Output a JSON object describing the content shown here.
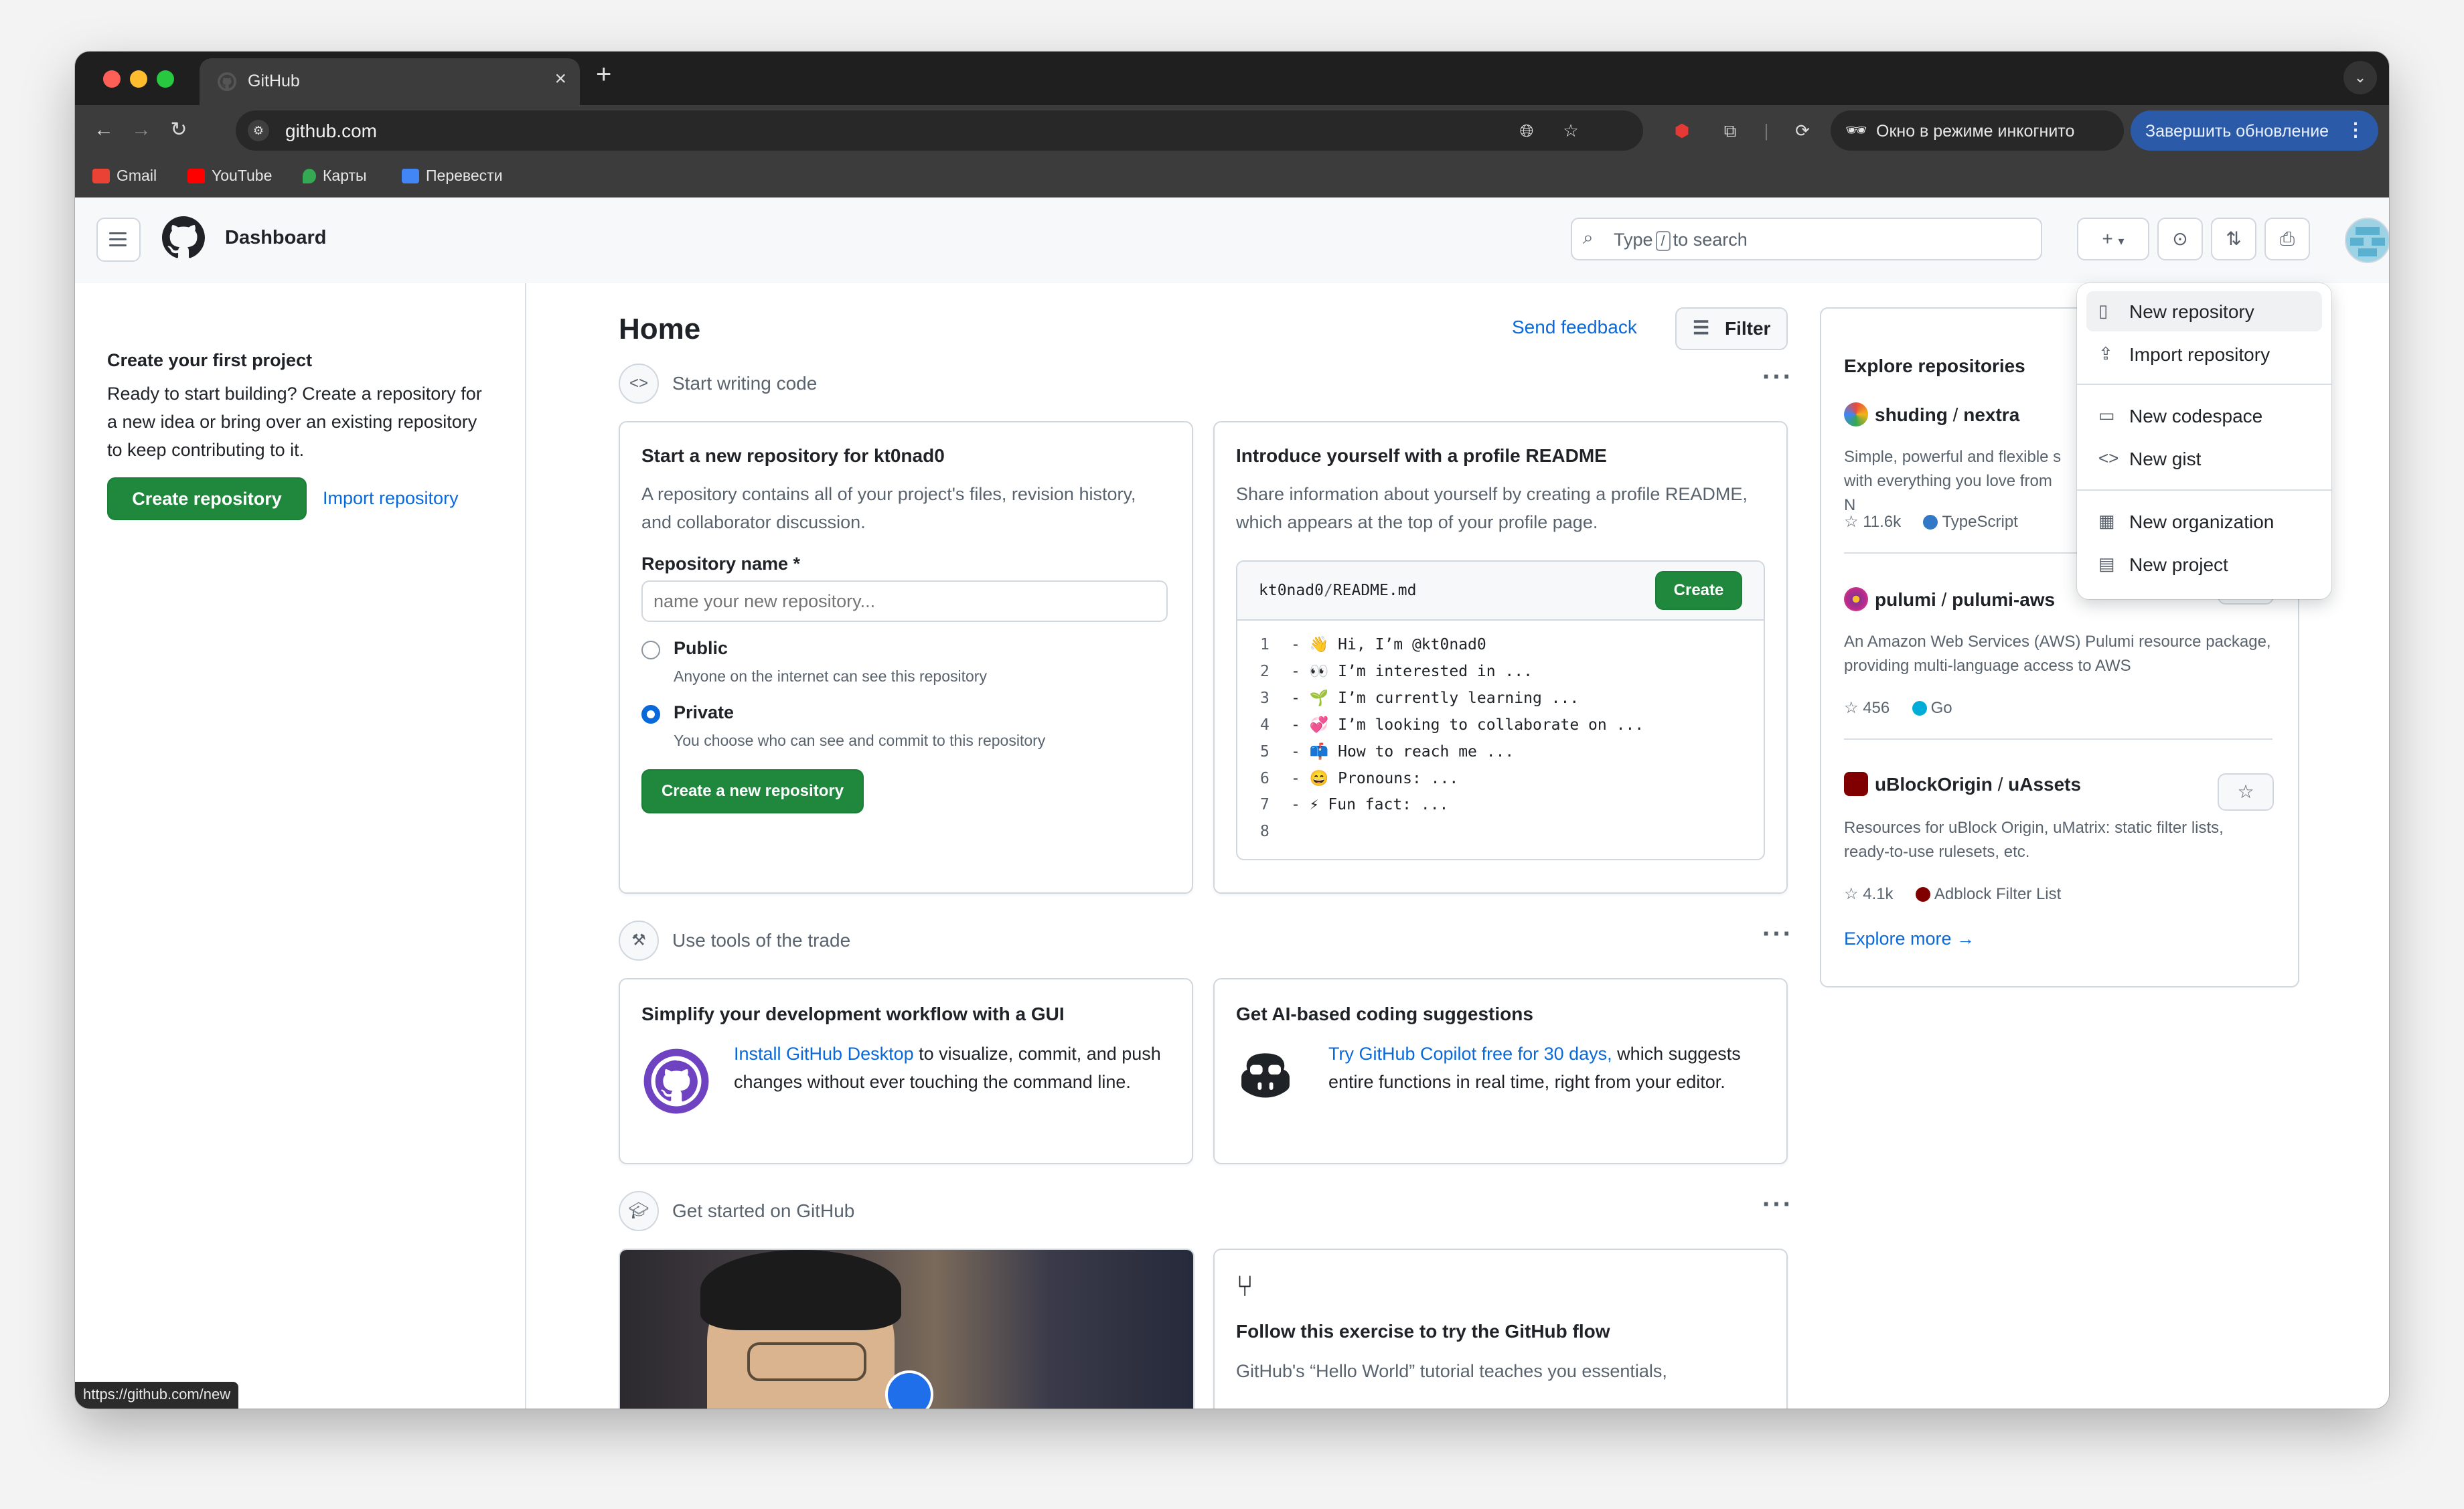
{
  "browser": {
    "tab_title": "GitHub",
    "url": "github.com",
    "incognito_label": "Окно в режиме инкогнито",
    "update_label": "Завершить обновление",
    "bookmarks": [
      {
        "label": "Gmail",
        "color": "#ea4335"
      },
      {
        "label": "YouTube",
        "color": "#ff0000"
      },
      {
        "label": "Карты",
        "color": "#34a853"
      },
      {
        "label": "Перевести",
        "color": "#4285f4"
      }
    ],
    "status_url": "https://github.com/new"
  },
  "header": {
    "title": "Dashboard",
    "search_prefix": "Type",
    "search_key": "/",
    "search_suffix": "to search"
  },
  "sidebar": {
    "heading": "Create your first project",
    "text": "Ready to start building? Create a repository for a new idea or bring over an existing repository to keep contributing to it.",
    "create_label": "Create repository",
    "import_label": "Import repository"
  },
  "main": {
    "title": "Home",
    "feedback": "Send feedback",
    "filter": "Filter",
    "sections": [
      {
        "title": "Start writing code"
      },
      {
        "title": "Use tools of the trade"
      },
      {
        "title": "Get started on GitHub"
      }
    ],
    "new_repo": {
      "heading": "Start a new repository for kt0nad0",
      "text": "A repository contains all of your project's files, revision history, and collaborator discussion.",
      "name_label": "Repository name *",
      "name_placeholder": "name your new repository...",
      "public_label": "Public",
      "public_sub": "Anyone on the internet can see this repository",
      "private_label": "Private",
      "private_sub": "You choose who can see and commit to this repository",
      "submit": "Create a new repository"
    },
    "readme": {
      "heading": "Introduce yourself with a profile README",
      "text": "Share information about yourself by creating a profile README, which appears at the top of your profile page.",
      "path_user": "kt0nad0",
      "path_sep": "/",
      "path_file": "README.md",
      "create": "Create",
      "lines": [
        {
          "n": "1",
          "t": "- 👋 Hi, I’m @kt0nad0"
        },
        {
          "n": "2",
          "t": "- 👀 I’m interested in ..."
        },
        {
          "n": "3",
          "t": "- 🌱 I’m currently learning ..."
        },
        {
          "n": "4",
          "t": "- 💞️ I’m looking to collaborate on ..."
        },
        {
          "n": "5",
          "t": "- 📫 How to reach me ..."
        },
        {
          "n": "6",
          "t": "- 😄 Pronouns: ..."
        },
        {
          "n": "7",
          "t": "- ⚡ Fun fact: ..."
        },
        {
          "n": "8",
          "t": ""
        }
      ]
    },
    "desktop": {
      "heading": "Simplify your development workflow with a GUI",
      "link": "Install GitHub Desktop",
      "text": " to visualize, commit, and push changes without ever touching the command line."
    },
    "copilot": {
      "heading": "Get AI-based coding suggestions",
      "link": "Try GitHub Copilot free for 30 days,",
      "text": " which suggests entire functions in real time, right from your editor."
    },
    "flow": {
      "heading": "Follow this exercise to try the GitHub flow",
      "text": "GitHub's “Hello World” tutorial teaches you essentials,"
    }
  },
  "explore": {
    "heading": "Explore repositories",
    "repos": [
      {
        "owner": "shuding",
        "sep": " / ",
        "name": "nextra",
        "desc": "Simple, powerful and flexible s with everything you love from N",
        "stars": "11.6k",
        "lang": "TypeScript",
        "lang_color": "#3178c6"
      },
      {
        "owner": "pulumi",
        "sep": " / ",
        "name": "pulumi-aws",
        "desc": "An Amazon Web Services (AWS) Pulumi resource package, providing multi-language access to AWS",
        "stars": "456",
        "lang": "Go",
        "lang_color": "#00add8"
      },
      {
        "owner": "uBlockOrigin",
        "sep": " / ",
        "name": "uAssets",
        "desc": "Resources for uBlock Origin, uMatrix: static filter lists, ready-to-use rulesets, etc.",
        "stars": "4.1k",
        "lang": "Adblock Filter List",
        "lang_color": "#800000"
      }
    ],
    "more": "Explore more →"
  },
  "dropdown": {
    "items": [
      {
        "label": "New repository"
      },
      {
        "label": "Import repository"
      },
      {
        "label": "New codespace"
      },
      {
        "label": "New gist"
      },
      {
        "label": "New organization"
      },
      {
        "label": "New project"
      }
    ]
  }
}
